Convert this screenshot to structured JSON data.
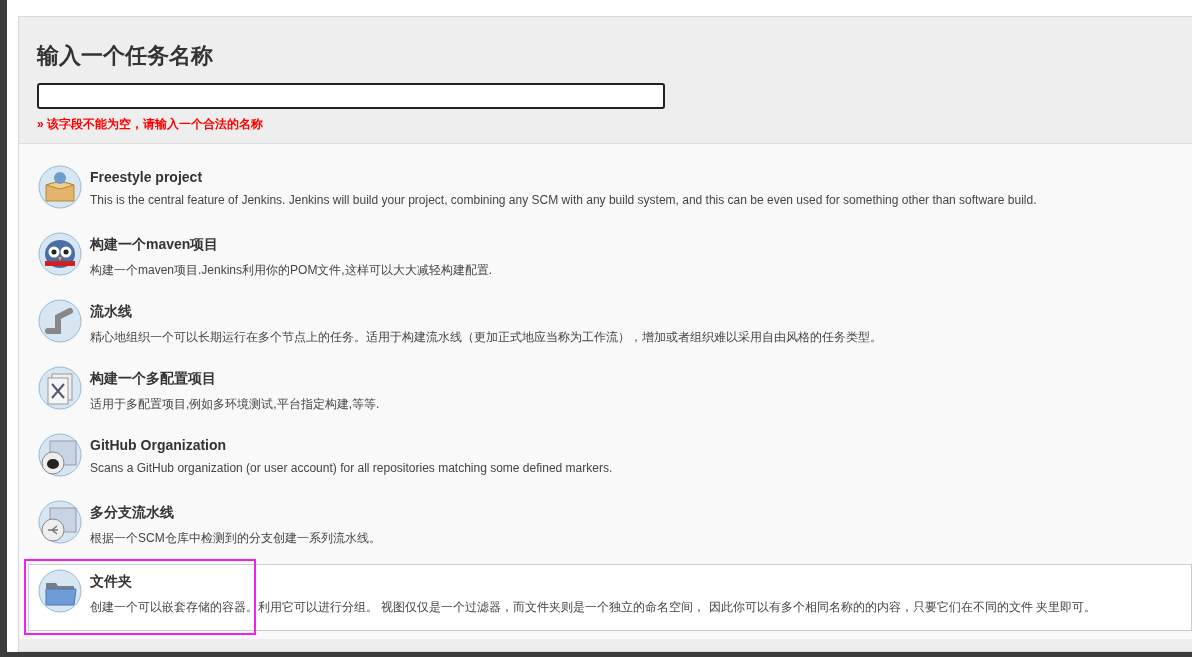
{
  "heading": "输入一个任务名称",
  "error": "» 该字段不能为空，请输入一个合法的名称",
  "items": [
    {
      "kind": "freestyle",
      "title": "Freestyle project",
      "description": "This is the central feature of Jenkins. Jenkins will build your project, combining any SCM with any build system, and this can be even used for something other than software build.",
      "selected": false
    },
    {
      "kind": "maven",
      "title": "构建一个maven项目",
      "description": "构建一个maven项目.Jenkins利用你的POM文件,这样可以大大减轻构建配置.",
      "selected": false
    },
    {
      "kind": "pipeline",
      "title": "流水线",
      "description": "精心地组织一个可以长期运行在多个节点上的任务。适用于构建流水线（更加正式地应当称为工作流），增加或者组织难以采用自由风格的任务类型。",
      "selected": false
    },
    {
      "kind": "matrix",
      "title": "构建一个多配置项目",
      "description": "适用于多配置项目,例如多环境测试,平台指定构建,等等.",
      "selected": false
    },
    {
      "kind": "github",
      "title": "GitHub Organization",
      "description": "Scans a GitHub organization (or user account) for all repositories matching some defined markers.",
      "selected": false
    },
    {
      "kind": "multibranch",
      "title": "多分支流水线",
      "description": "根据一个SCM仓库中检测到的分支创建一系列流水线。",
      "selected": false
    },
    {
      "kind": "folder",
      "title": "文件夹",
      "description": "创建一个可以嵌套存储的容器。利用它可以进行分组。 视图仅仅是一个过滤器，而文件夹则是一个独立的命名空间， 因此你可以有多个相同名称的的内容，只要它们在不同的文件 夹里即可。",
      "selected": true
    }
  ]
}
